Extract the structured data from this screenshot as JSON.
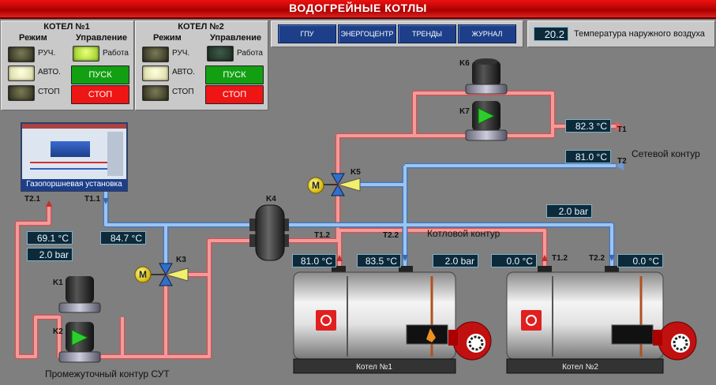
{
  "title": "ВОДОГРЕЙНЫЕ КОТЛЫ",
  "boiler1": {
    "title": "КОТЕЛ №1",
    "mode_label": "Режим",
    "control_label": "Управление",
    "modes": [
      "РУЧ.",
      "АВТО.",
      "СТОП"
    ],
    "work_label": "Работа",
    "start": "ПУСК",
    "stop": "СТОП"
  },
  "boiler2": {
    "title": "КОТЕЛ №2",
    "mode_label": "Режим",
    "control_label": "Управление",
    "modes": [
      "РУЧ.",
      "АВТО.",
      "СТОП"
    ],
    "work_label": "Работа",
    "start": "ПУСК",
    "stop": "СТОП"
  },
  "nav": [
    "ГПУ",
    "ЭНЕРГОЦЕНТР",
    "ТРЕНДЫ",
    "ЖУРНАЛ"
  ],
  "outdoor": {
    "value": "20.2",
    "label": "Температура наружного воздуха"
  },
  "gpu_label": "Газопоршневая установка",
  "labels": {
    "k1": "K1",
    "k2": "K2",
    "k3": "K3",
    "k4": "K4",
    "k5": "K5",
    "k6": "K6",
    "k7": "K7",
    "t1": "T1",
    "t2": "T2",
    "t21": "T2.1",
    "t11": "T1.1",
    "t12a": "T1.2",
    "t22a": "T2.2",
    "t12b": "T1.2",
    "t22b": "T2.2",
    "m": "M",
    "network": "Сетевой контур",
    "boiler_loop": "Котловой контур",
    "intermediate": "Промежуточный контур СУТ",
    "boiler1_name": "Котел №1",
    "boiler2_name": "Котел №2"
  },
  "readings": {
    "t1": "82.3 °C",
    "t2": "81.0 °C",
    "net_pressure": "2.0 bar",
    "t21": "69.1 °C",
    "p21": "2.0 bar",
    "t11": "84.7 °C",
    "b1_t12": "81.0 °C",
    "b1_t22": "83.5 °C",
    "b1_p": "2.0 bar",
    "b2_t12": "0.0 °C",
    "b2_t22": "0.0 °C"
  },
  "colors": {
    "hot": "#f08a8a",
    "cold": "#8ab4e8",
    "accent_red": "#d01010",
    "nav_blue": "#1d3f8a"
  }
}
